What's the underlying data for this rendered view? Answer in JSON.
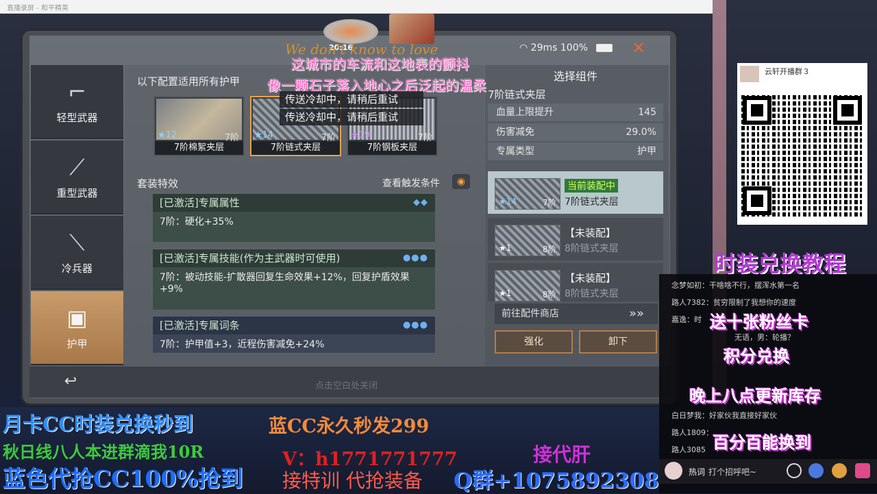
{
  "window": {
    "title": "直播录屏 - 和平精英"
  },
  "hud": {
    "ping": "29ms",
    "battery": "100%",
    "time": "20:16"
  },
  "lyrics": {
    "deco": "We don't know to love",
    "line1": "这城市的车流和这地表的颤抖",
    "line2": "像一颗石子落入地心之后泛起的温柔"
  },
  "toasts": [
    "传送冷却中，请稍后重试",
    "传送冷却中，请稍后重试"
  ],
  "nav": {
    "items": [
      {
        "label": "轻型武器",
        "icon": "smg-icon"
      },
      {
        "label": "重型武器",
        "icon": "rocket-launcher-icon"
      },
      {
        "label": "冷兵器",
        "icon": "knife-icon"
      },
      {
        "label": "护甲",
        "icon": "armor-vest-icon"
      }
    ],
    "active": "护甲"
  },
  "config": {
    "header": "以下配置适用所有护甲",
    "cards": [
      {
        "name": "7阶棉絮夹层",
        "star": "12",
        "tier": "7阶"
      },
      {
        "name": "7阶链式夹层",
        "star": "14",
        "tier": "7阶"
      },
      {
        "name": "7阶钢板夹层",
        "star": "19",
        "tier": "7阶"
      }
    ]
  },
  "set_effects": {
    "title": "套装特效",
    "trigger_link": "查看触发条件",
    "items": [
      {
        "head": "[已激活]专属属性",
        "body": "7阶：硬化+35%"
      },
      {
        "head": "[已激活]专属技能(作为主武器时可使用)",
        "body": "7阶：被动技能-扩散器回复生命效果+12%，回复护盾效果+9%"
      },
      {
        "head": "[已激活]专属词条",
        "body": "7阶：护甲值+3，近程伤害减免+24%"
      }
    ]
  },
  "right": {
    "title": "选择组件",
    "component": "7阶链式夹层",
    "stats": [
      {
        "label": "血量上限提升",
        "value": "145"
      },
      {
        "label": "伤害减免",
        "value": "29.0%"
      },
      {
        "label": "专属类型",
        "value": "护甲"
      }
    ],
    "slots": [
      {
        "status": "当前装配中",
        "name": "7阶链式夹层",
        "star": "14",
        "tier": "7阶"
      },
      {
        "status": "【未装配】",
        "name": "8阶链式夹层",
        "star": "1",
        "tier": "8阶"
      },
      {
        "status": "【未装配】",
        "name": "8阶链式夹层",
        "star": "1",
        "tier": "8阶"
      }
    ],
    "shop_link": "前往配件商店",
    "enhance": "强化",
    "unequip": "卸下"
  },
  "bottom_hint": "点击空白处关闭",
  "qr": {
    "name": "云轩开播群３"
  },
  "promos": {
    "tutorial": "时装兑换教程",
    "monthly": "月卡CC时装兑换秒到",
    "blue": "蓝CC永久秒发299",
    "group": "秋日线八人本进群滴我10R",
    "qq": "V：h1771771777",
    "boost": "接代肝",
    "grab": "蓝色代抢CC100%抢到",
    "train": "接特训 代抢装备",
    "qgroup": "Q群+1075892308"
  },
  "chat": {
    "lines": [
      "念梦如初：干啥啥不行，摆浑水第一名",
      "路人7382：贫穷限制了我想你的速度",
      "嘉逸：时",
      "无语，男：轮播？",
      "白日梦我：好家伙我直接好家伙",
      "路人1809：",
      "路人3085"
    ],
    "promo_lines": [
      "送十张粉丝卡",
      "积分兑换",
      "晚上八点更新库存",
      "百分百能换到"
    ],
    "hot_label": "热词",
    "placeholder": "打个招呼吧~"
  }
}
